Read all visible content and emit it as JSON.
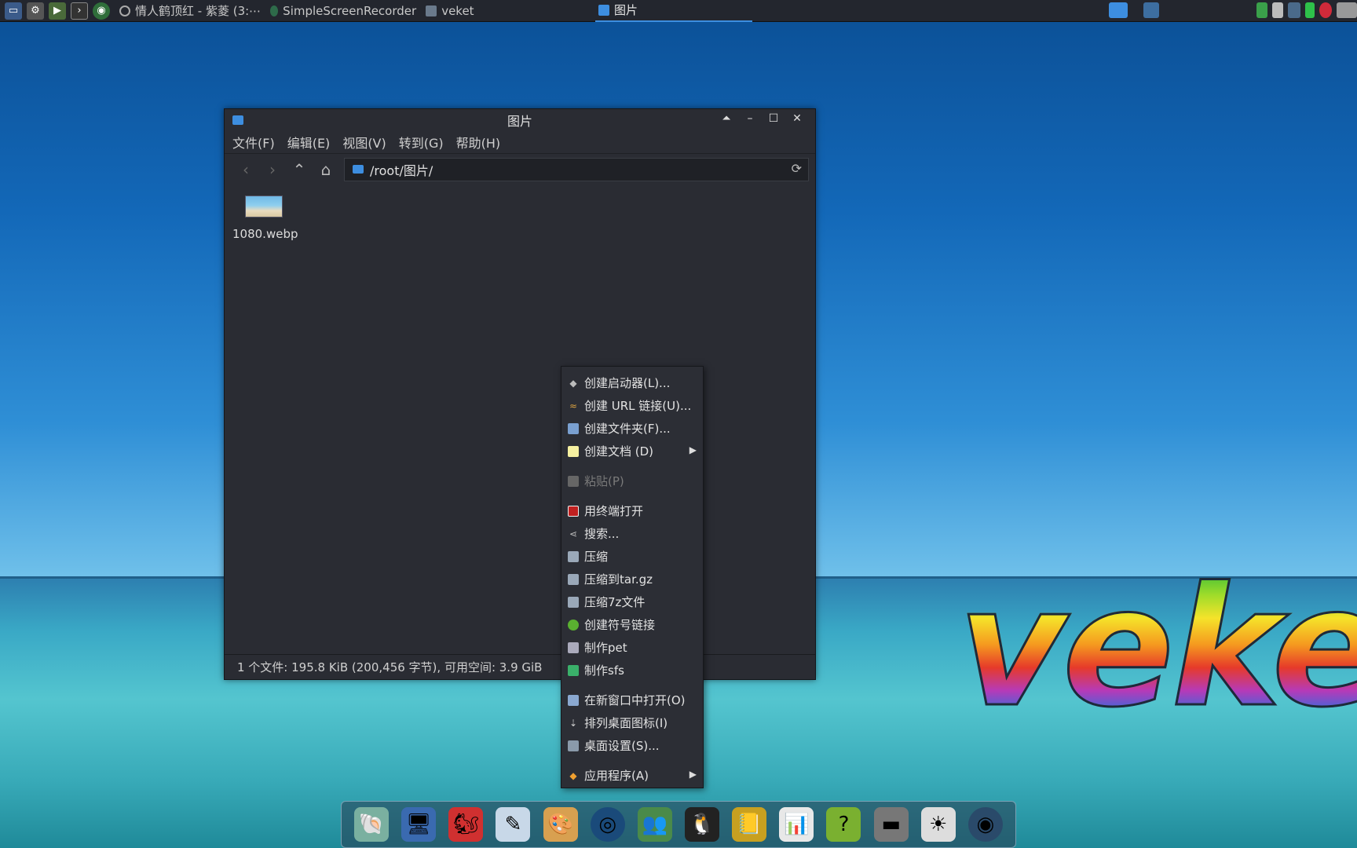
{
  "taskbar": {
    "tasks": [
      {
        "label": "情人鹤顶红 - 紫菱 (3:⋯"
      },
      {
        "label": "SimpleScreenRecorder"
      },
      {
        "label": "veket"
      },
      {
        "label": "图片"
      }
    ]
  },
  "window": {
    "title": "图片",
    "menu": [
      "文件(F)",
      "编辑(E)",
      "视图(V)",
      "转到(G)",
      "帮助(H)"
    ],
    "address": "/root/图片/",
    "files": [
      {
        "name": "1080.webp"
      }
    ],
    "status": "1 个文件: 195.8 KiB (200,456 字节), 可用空间: 3.9 GiB"
  },
  "context_menu": {
    "items": [
      {
        "label": "创建启动器(L)...",
        "icon": "launcher-icon"
      },
      {
        "label": "创建 URL 链接(U)...",
        "icon": "link-icon"
      },
      {
        "label": "创建文件夹(F)...",
        "icon": "folder-icon"
      },
      {
        "label": "创建文档 (D)",
        "icon": "document-icon"
      },
      {
        "label": "粘贴(P)",
        "icon": "paste-icon"
      },
      {
        "label": "用终端打开",
        "icon": "terminal-icon"
      },
      {
        "label": "搜索...",
        "icon": "search-icon"
      },
      {
        "label": "压缩",
        "icon": "archive-icon"
      },
      {
        "label": "压缩到tar.gz",
        "icon": "archive-icon"
      },
      {
        "label": "压缩7z文件",
        "icon": "archive-icon"
      },
      {
        "label": "创建符号链接",
        "icon": "symlink-icon"
      },
      {
        "label": "制作pet",
        "icon": "package-icon"
      },
      {
        "label": "制作sfs",
        "icon": "sfs-icon"
      },
      {
        "label": "在新窗口中打开(O)",
        "icon": "new-window-icon"
      },
      {
        "label": "排列桌面图标(I)",
        "icon": "sort-icon"
      },
      {
        "label": "桌面设置(S)...",
        "icon": "desktop-settings-icon"
      },
      {
        "label": "应用程序(A)",
        "icon": "applications-icon"
      }
    ]
  },
  "brand": "veket"
}
